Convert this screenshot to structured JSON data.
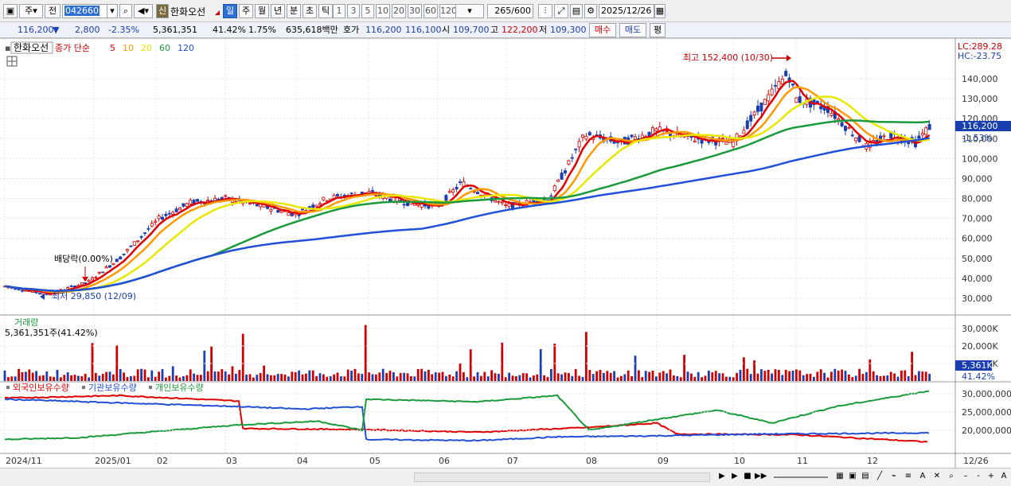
{
  "toolbar": {
    "period_label": "주",
    "jeon_label": "전",
    "code": "042660",
    "sin_badge": "신",
    "stock_name": "한화오선",
    "tabs": [
      "일",
      "주",
      "월",
      "년",
      "분",
      "초",
      "틱"
    ],
    "active_tab": "일",
    "intervals": [
      "1",
      "3",
      "5",
      "10",
      "20",
      "30",
      "60",
      "120"
    ],
    "count": "265",
    "count_max": "/600",
    "date": "2025/12/26"
  },
  "quote": {
    "price": "116,200",
    "change": "2,800",
    "change_pct": "-2.35%",
    "volume": "5,361,351",
    "vol_ratio": "41.42%",
    "turnover_pct": "1.75%",
    "amount": "635,618백만",
    "hoga_label": "호가",
    "ask": "116,200",
    "bid": "116,100",
    "open_label": "시",
    "open": "109,700",
    "high_label": "고",
    "high": "122,200",
    "low_label": "저",
    "low": "109,300",
    "buy_button": "매수",
    "sell_button": "매도",
    "eval_button": "평"
  },
  "legend": {
    "stock_name": "한화오선",
    "ma_title": "종가 단순",
    "ma_periods": [
      "5",
      "10",
      "20",
      "60",
      "120"
    ],
    "ma_colors": [
      "#e00000",
      "#ff9900",
      "#e8e800",
      "#1a9a3a",
      "#2050d8"
    ]
  },
  "annotations": {
    "high": "최고 152,400 (10/30)",
    "low": "최저 29,850 (12/09)",
    "dividend": "배당락(0.00%)",
    "lc": "LC:289.28",
    "hc": "HC:-23.75"
  },
  "price_axis": {
    "ticks": [
      "140,000",
      "130,000",
      "120,000",
      "110,000",
      "100,000",
      "90,000",
      "80,000",
      "70,000",
      "60,000",
      "50,000",
      "40,000",
      "30,000"
    ],
    "current": "116,200",
    "current_pct": "-1.53%"
  },
  "volume_panel": {
    "title": "거래량",
    "value": "5,361,351주(41.42%)",
    "ticks": [
      "30,000K",
      "20,000K",
      "10,000K"
    ],
    "current": "5,361K",
    "current_pct": "41.42%"
  },
  "holdings_panel": {
    "series": [
      "외국인보유수량",
      "기관보유수량",
      "개인보유수량"
    ],
    "colors": [
      "#e00000",
      "#2050d8",
      "#1a9a3a"
    ],
    "ticks": [
      "30,000,000",
      "25,000,000",
      "20,000,000"
    ]
  },
  "date_axis": {
    "labels": [
      "2024/11",
      "2025/01",
      "02",
      "03",
      "04",
      "05",
      "06",
      "07",
      "08",
      "09",
      "10",
      "11",
      "12"
    ],
    "right_label": "12/26"
  },
  "chart_data": {
    "type": "candlestick",
    "approximate_closes_by_month": {
      "2024-11": 35000,
      "2024-12": 31000,
      "2025-01": 48000,
      "2025-02": 75000,
      "2025-03": 80000,
      "2025-04": 72000,
      "2025-05": 82000,
      "2025-06": 76000,
      "2025-07": 84000,
      "2025-08": 110000,
      "2025-09": 112000,
      "2025-10": 140000,
      "2025-11": 125000,
      "2025-12": 116200
    },
    "price_ylim": [
      25000,
      155000
    ],
    "volume_ylim": [
      0,
      33000000
    ],
    "holdings_ylim": [
      17000000,
      32000000
    ]
  }
}
